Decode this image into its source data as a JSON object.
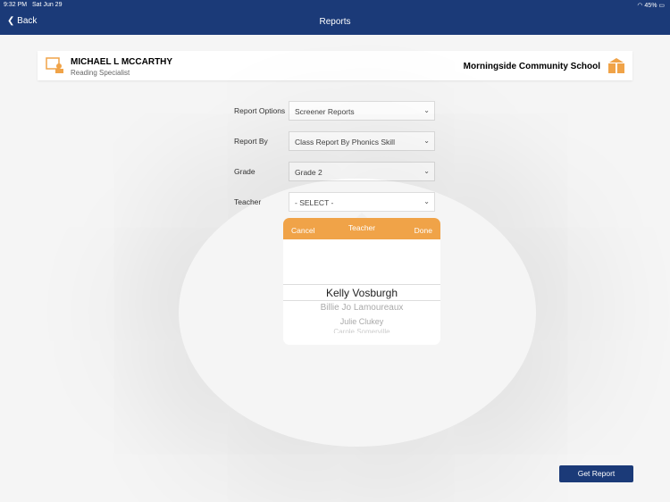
{
  "status": {
    "time": "9:32 PM",
    "date": "Sat Jun 29",
    "battery": "45%"
  },
  "nav": {
    "back": "Back",
    "title": "Reports"
  },
  "user": {
    "name": "MICHAEL L MCCARTHY",
    "role": "Reading Specialist",
    "school": "Morningside Community School"
  },
  "form": [
    {
      "label": "Report Options",
      "value": "Screener Reports"
    },
    {
      "label": "Report By",
      "value": "Class Report By Phonics Skill"
    },
    {
      "label": "Grade",
      "value": "Grade 2"
    },
    {
      "label": "Teacher",
      "value": "- SELECT -"
    }
  ],
  "picker": {
    "cancel": "Cancel",
    "title": "Teacher",
    "done": "Done",
    "selected": "Kelly Vosburgh",
    "options": [
      "Billie Jo Lamoureaux",
      "Julie Clukey",
      "Carole Somerville"
    ]
  },
  "get_report": "Get Report",
  "colors": {
    "nav": "#1b3a78",
    "accent": "#f0a348"
  }
}
